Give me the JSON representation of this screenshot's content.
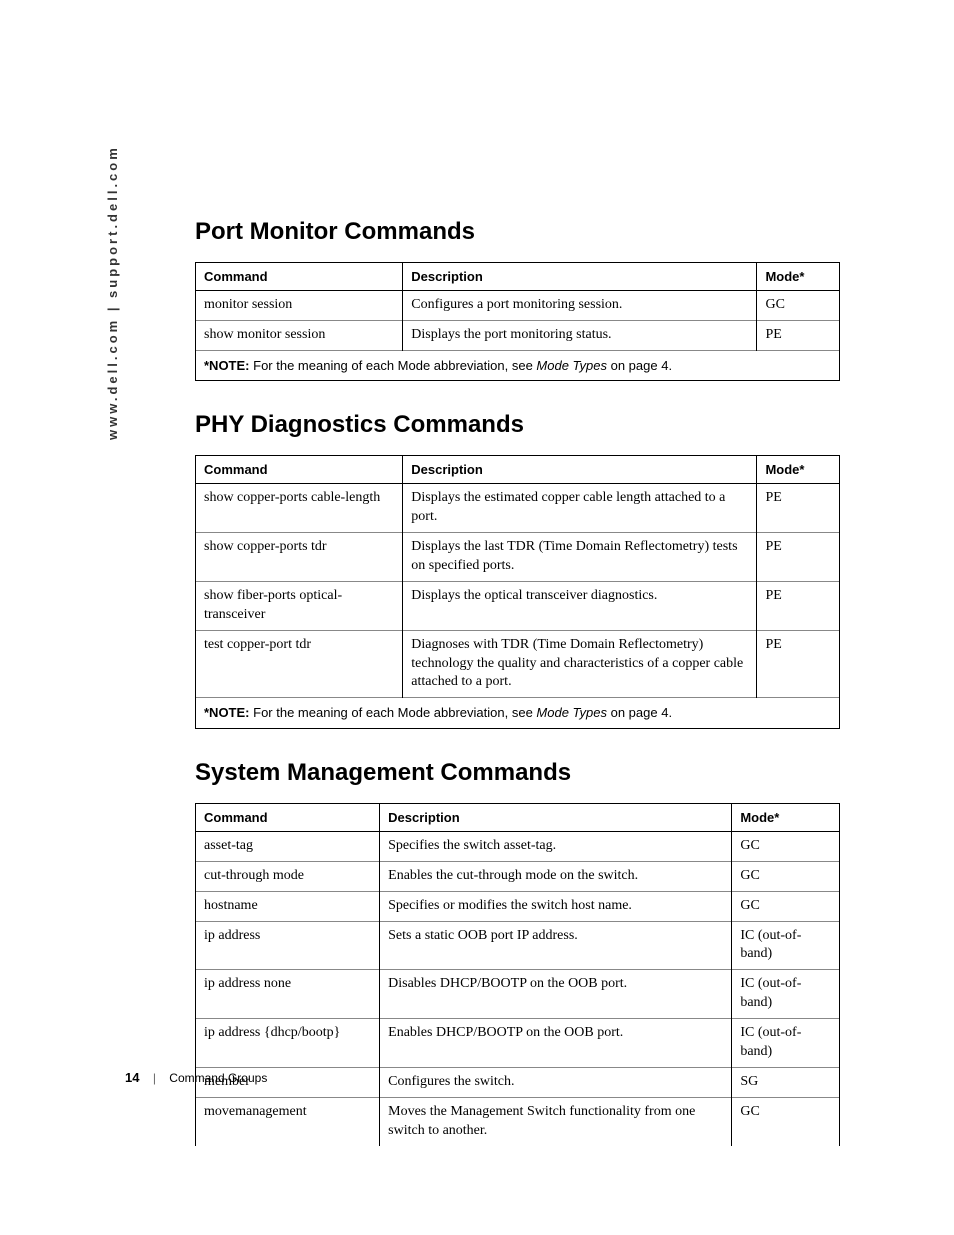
{
  "sidebar": "www.dell.com | support.dell.com",
  "sections": [
    {
      "title": "Port Monitor Commands",
      "cols": [
        "Command",
        "Description",
        "Mode*"
      ],
      "rows": [
        {
          "cmd": "monitor session",
          "desc": "Configures a port monitoring session.",
          "mode": "GC"
        },
        {
          "cmd": "show monitor session",
          "desc": "Displays the port monitoring status.",
          "mode": "PE"
        }
      ],
      "note": {
        "prefix": "*NOTE: ",
        "body1": "For the meaning of each Mode abbreviation, see ",
        "italic": "Mode Types",
        "body2": " on page 4."
      }
    },
    {
      "title": "PHY Diagnostics Commands",
      "cols": [
        "Command",
        "Description",
        "Mode*"
      ],
      "rows": [
        {
          "cmd": "show copper-ports cable-length",
          "desc": "Displays the estimated copper cable length attached to a port.",
          "mode": "PE"
        },
        {
          "cmd": "show copper-ports tdr",
          "desc": "Displays the last TDR (Time Domain Reflectometry) tests on specified ports.",
          "mode": "PE"
        },
        {
          "cmd": "show fiber-ports optical-transceiver",
          "desc": "Displays the optical transceiver diagnostics.",
          "mode": "PE"
        },
        {
          "cmd": "test copper-port tdr",
          "desc": "Diagnoses with TDR (Time Domain Reflectometry) technology the quality and characteristics of a copper cable attached to a port.",
          "mode": "PE"
        }
      ],
      "note": {
        "prefix": "*NOTE: ",
        "body1": "For the meaning of each Mode abbreviation, see ",
        "italic": "Mode Types",
        "body2": " on page 4."
      }
    },
    {
      "title": "System Management Commands",
      "cols": [
        "Command",
        "Description",
        "Mode*"
      ],
      "rows": [
        {
          "cmd": "asset-tag",
          "desc": "Specifies the switch asset-tag.",
          "mode": "GC"
        },
        {
          "cmd": "cut-through mode",
          "desc": "Enables the cut-through mode on the switch.",
          "mode": "GC"
        },
        {
          "cmd": "hostname",
          "desc": "Specifies or modifies the switch host name.",
          "mode": "GC"
        },
        {
          "cmd": "ip address",
          "desc": "Sets a static OOB port IP address.",
          "mode": "IC (out-of-band)"
        },
        {
          "cmd": "ip address none",
          "desc": "Disables DHCP/BOOTP on the OOB port.",
          "mode": "IC (out-of-band)"
        },
        {
          "cmd": "ip address {dhcp/bootp}",
          "desc": "Enables DHCP/BOOTP on the OOB port.",
          "mode": "IC (out-of-band)"
        },
        {
          "cmd": "member",
          "desc": "Configures the switch.",
          "mode": "SG"
        },
        {
          "cmd": "movemanagement",
          "desc": "Moves the Management Switch functionality from one switch to another.",
          "mode": "GC"
        }
      ]
    }
  ],
  "footer": {
    "page": "14",
    "label": "Command Groups"
  }
}
